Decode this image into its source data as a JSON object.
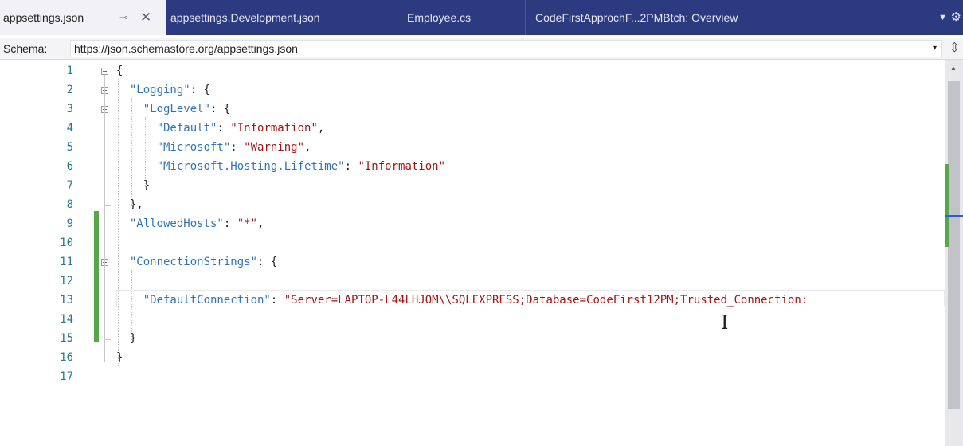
{
  "tabs": [
    {
      "label": "appsettings.json",
      "active": true,
      "pin_icon": "pin-icon",
      "close_icon": "close-icon"
    },
    {
      "label": "appsettings.Development.json",
      "active": false
    },
    {
      "label": "Employee.cs",
      "active": false
    },
    {
      "label": "CodeFirstApprochF...2PMBtch: Overview",
      "active": false
    }
  ],
  "tab_icons": {
    "pin": "⊸",
    "close": "✕",
    "dropdown": "▼",
    "gear": "⚙"
  },
  "schema": {
    "label": "Schema:",
    "value": "https://json.schemastore.org/appsettings.json",
    "dropdown_icon": "▾",
    "split_icon": "⇳"
  },
  "editor": {
    "line_numbers": [
      "1",
      "2",
      "3",
      "4",
      "5",
      "6",
      "7",
      "8",
      "9",
      "10",
      "11",
      "12",
      "13",
      "14",
      "15",
      "16",
      "17"
    ],
    "lines": [
      {
        "n": "1",
        "tokens": [
          {
            "t": "p",
            "v": "{"
          }
        ]
      },
      {
        "n": "2",
        "tokens": [
          {
            "t": "k",
            "v": "  \"Logging\""
          },
          {
            "t": "p",
            "v": ": {"
          }
        ]
      },
      {
        "n": "3",
        "tokens": [
          {
            "t": "k",
            "v": "    \"LogLevel\""
          },
          {
            "t": "p",
            "v": ": {"
          }
        ]
      },
      {
        "n": "4",
        "tokens": [
          {
            "t": "k",
            "v": "      \"Default\""
          },
          {
            "t": "p",
            "v": ": "
          },
          {
            "t": "s",
            "v": "\"Information\""
          },
          {
            "t": "p",
            "v": ","
          }
        ]
      },
      {
        "n": "5",
        "tokens": [
          {
            "t": "k",
            "v": "      \"Microsoft\""
          },
          {
            "t": "p",
            "v": ": "
          },
          {
            "t": "s",
            "v": "\"Warning\""
          },
          {
            "t": "p",
            "v": ","
          }
        ]
      },
      {
        "n": "6",
        "tokens": [
          {
            "t": "k",
            "v": "      \"Microsoft.Hosting.Lifetime\""
          },
          {
            "t": "p",
            "v": ": "
          },
          {
            "t": "s",
            "v": "\"Information\""
          }
        ]
      },
      {
        "n": "7",
        "tokens": [
          {
            "t": "p",
            "v": "    }"
          }
        ]
      },
      {
        "n": "8",
        "tokens": [
          {
            "t": "p",
            "v": "  },"
          }
        ]
      },
      {
        "n": "9",
        "tokens": [
          {
            "t": "k",
            "v": "  \"AllowedHosts\""
          },
          {
            "t": "p",
            "v": ": "
          },
          {
            "t": "s",
            "v": "\"*\""
          },
          {
            "t": "p",
            "v": ","
          }
        ]
      },
      {
        "n": "10",
        "tokens": []
      },
      {
        "n": "11",
        "tokens": [
          {
            "t": "k",
            "v": "  \"ConnectionStrings\""
          },
          {
            "t": "p",
            "v": ": {"
          }
        ]
      },
      {
        "n": "12",
        "tokens": []
      },
      {
        "n": "13",
        "tokens": [
          {
            "t": "k",
            "v": "    \"DefaultConnection\""
          },
          {
            "t": "p",
            "v": ": "
          },
          {
            "t": "s",
            "v": "\"Server=LAPTOP-L44LHJOM\\\\SQLEXPRESS;Database=CodeFirst12PM;Trusted_Connection:"
          }
        ]
      },
      {
        "n": "14",
        "tokens": []
      },
      {
        "n": "15",
        "tokens": [
          {
            "t": "p",
            "v": "  }"
          }
        ]
      },
      {
        "n": "16",
        "tokens": [
          {
            "t": "p",
            "v": "}"
          }
        ]
      },
      {
        "n": "17",
        "tokens": []
      }
    ],
    "cursor_glyph": "I"
  },
  "scrollbar": {
    "up_arrow": "▲"
  },
  "colors": {
    "tab_strip": "#2c3a80",
    "active_tab": "#f2f2f6",
    "json_key": "#2e75b6",
    "json_string": "#a31515",
    "line_number": "#237893",
    "change_marker": "#57a64a",
    "scroll_caret": "#2b5ce6"
  }
}
